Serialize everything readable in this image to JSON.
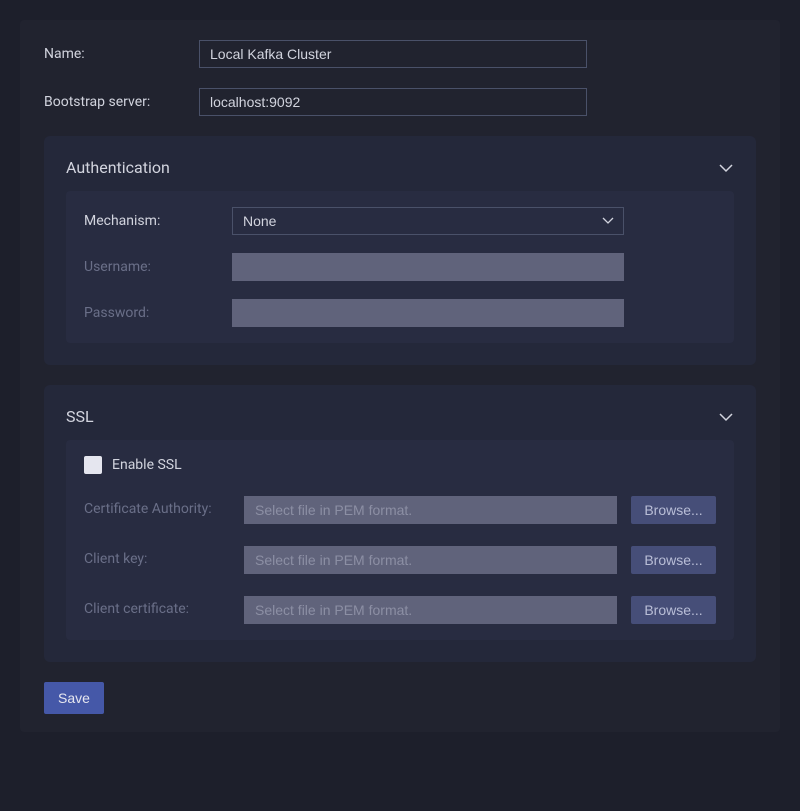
{
  "name": {
    "label": "Name:",
    "value": "Local Kafka Cluster"
  },
  "bootstrap": {
    "label": "Bootstrap server:",
    "value": "localhost:9092"
  },
  "authentication": {
    "title": "Authentication",
    "mechanism": {
      "label": "Mechanism:",
      "value": "None"
    },
    "username": {
      "label": "Username:"
    },
    "password": {
      "label": "Password:"
    }
  },
  "ssl": {
    "title": "SSL",
    "enable_label": "Enable SSL",
    "ca": {
      "label": "Certificate Authority:",
      "placeholder": "Select file in PEM format.",
      "browse": "Browse..."
    },
    "client_key": {
      "label": "Client key:",
      "placeholder": "Select file in PEM format.",
      "browse": "Browse..."
    },
    "client_cert": {
      "label": "Client certificate:",
      "placeholder": "Select file in PEM format.",
      "browse": "Browse..."
    }
  },
  "save_label": "Save"
}
